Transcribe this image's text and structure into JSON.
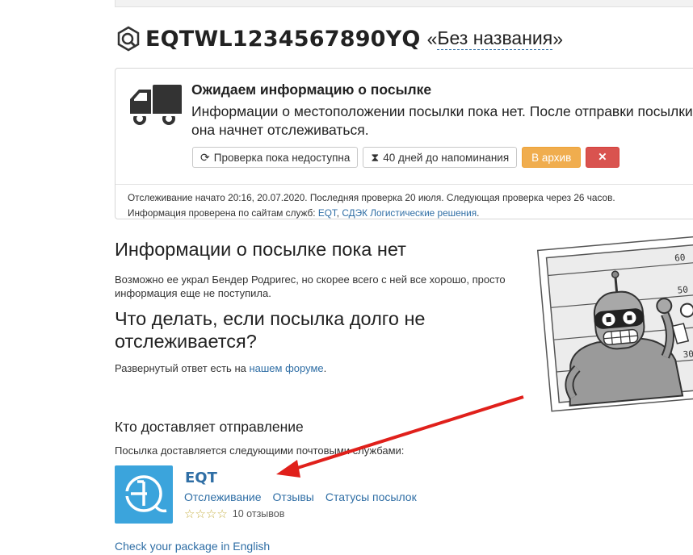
{
  "package": {
    "tracking_number": "EQTWL1234567890YQ",
    "name_open_quote": "«",
    "name": "Без названия",
    "name_close_quote": "»"
  },
  "status": {
    "title": "Ожидаем информацию о посылке",
    "description": "Информации о местоположении посылки пока нет. После отправки посылки она начнет отслеживаться.",
    "buttons": {
      "check": "Проверка пока недоступна",
      "reminder": "40 дней до напоминания",
      "archive": "В архив",
      "delete": "✕"
    },
    "footer_line1": "Отслеживание начато 20:16, 20.07.2020. Последняя проверка 20 июля. Следующая проверка через 26 часов.",
    "footer_line2_prefix": "Информация проверена по сайтам служб: ",
    "footer_service1": "EQT",
    "footer_sep": ", ",
    "footer_service2": "СДЭК Логистические решения",
    "footer_end": "."
  },
  "no_info": {
    "heading": "Информации о посылке пока нет",
    "text": "Возможно ее украл Бендер Родригес, но скорее всего с ней все хорошо, просто информация еще не поступила."
  },
  "what_to_do": {
    "heading": "Что делать, если посылка долго не отслеживается?",
    "text_prefix": "Развернутый ответ есть на ",
    "link": "нашем форуме",
    "text_suffix": "."
  },
  "delivery": {
    "heading": "Кто доставляет отправление",
    "text": "Посылка доставляется следующими почтовыми службами:",
    "carrier": {
      "name": "EQT",
      "links": [
        "Отслеживание",
        "Отзывы",
        "Статусы посылок"
      ],
      "reviews": "10 отзывов",
      "stars": "☆☆☆☆"
    }
  },
  "height_marks": [
    "60",
    "50",
    "30"
  ],
  "english_link": "Check your package in English",
  "colors": {
    "link": "#2f6ea5",
    "archive": "#f0ad4e",
    "delete": "#d9534f",
    "carrier_logo": "#3ba4dc",
    "arrow": "#e0201b"
  }
}
